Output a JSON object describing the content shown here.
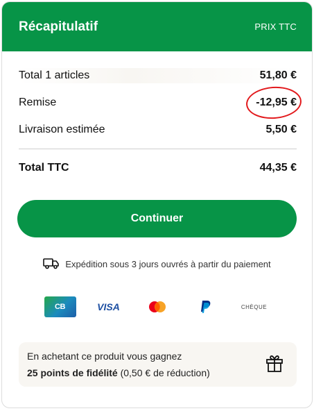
{
  "header": {
    "title": "Récapitulatif",
    "price_type": "PRIX TTC"
  },
  "summary": {
    "rows": [
      {
        "label": "Total 1 articles",
        "value": "51,80 €"
      },
      {
        "label": "Remise",
        "value": "-12,95 €"
      },
      {
        "label": "Livraison estimée",
        "value": "5,50 €"
      }
    ],
    "total": {
      "label": "Total TTC",
      "value": "44,35 €"
    }
  },
  "actions": {
    "continue_label": "Continuer"
  },
  "shipping": {
    "icon": "truck-icon",
    "text": "Expédition sous 3 jours ouvrés à partir du paiement"
  },
  "payments": [
    {
      "name": "CB",
      "icon": "carte-bancaire-icon"
    },
    {
      "name": "VISA",
      "icon": "visa-icon"
    },
    {
      "name": "",
      "icon": "mastercard-icon"
    },
    {
      "name": "",
      "icon": "paypal-icon"
    },
    {
      "name": "CHÈQUE",
      "icon": "cheque-icon"
    }
  ],
  "loyalty": {
    "line1": "En achetant ce produit vous gagnez",
    "points": "25 points de fidélité",
    "detail": " (0,50 € de réduction)",
    "icon": "gift-icon"
  },
  "colors": {
    "brand_green": "#079447",
    "annotation_red": "#e2191c"
  }
}
